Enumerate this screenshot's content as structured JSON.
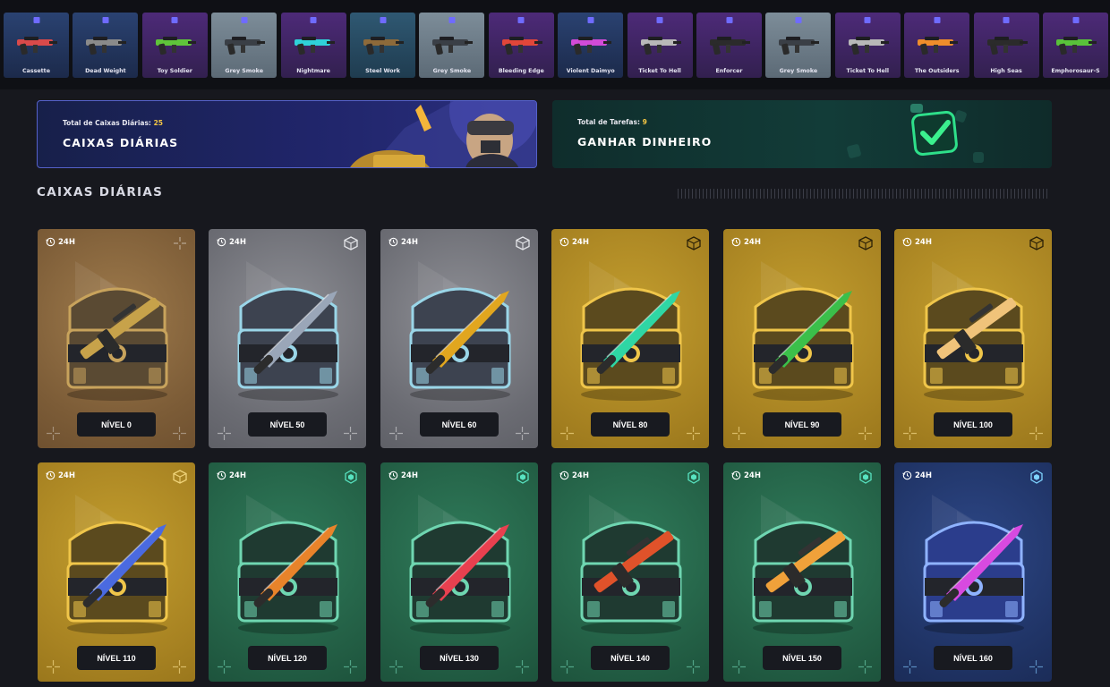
{
  "drops": [
    {
      "name": "Cassette",
      "rarity": "blue",
      "color": "#d94a4a"
    },
    {
      "name": "Dead Weight",
      "rarity": "blue",
      "color": "#8a8a8a"
    },
    {
      "name": "Toy Soldier",
      "rarity": "purple",
      "color": "#5fc43a"
    },
    {
      "name": "Grey Smoke",
      "rarity": "gray",
      "color": "#3a3f46"
    },
    {
      "name": "Nightmare",
      "rarity": "purple",
      "color": "#2fd1d8"
    },
    {
      "name": "Steel Work",
      "rarity": "teal",
      "color": "#8d6a3a"
    },
    {
      "name": "Grey Smoke",
      "rarity": "gray",
      "color": "#3a3f46"
    },
    {
      "name": "Bleeding Edge",
      "rarity": "purple",
      "color": "#e1463a"
    },
    {
      "name": "Violent Daimyo",
      "rarity": "blue",
      "color": "#d24bd8"
    },
    {
      "name": "Ticket To Hell",
      "rarity": "purple",
      "color": "#b8b8b8"
    },
    {
      "name": "Enforcer",
      "rarity": "purple",
      "color": "#2b2b2b"
    },
    {
      "name": "Grey Smoke",
      "rarity": "gray",
      "color": "#3a3f46"
    },
    {
      "name": "Ticket To Hell",
      "rarity": "purple",
      "color": "#b8b8b8"
    },
    {
      "name": "The Outsiders",
      "rarity": "purple",
      "color": "#ef8d2b"
    },
    {
      "name": "High Seas",
      "rarity": "purple",
      "color": "#2b2b2b"
    },
    {
      "name": "Emphorosaur-S",
      "rarity": "purple",
      "color": "#59c23a"
    }
  ],
  "banners": {
    "daily": {
      "count_label": "Total de Caixas Diárias:",
      "count": "25",
      "title": "CAIXAS DIÁRIAS"
    },
    "money": {
      "count_label": "Total de Tarefas:",
      "count": "9",
      "title": "GANHAR DINHEIRO"
    }
  },
  "section_title": "CAIXAS DIÁRIAS",
  "cards": [
    {
      "level": "NÍVEL 0",
      "timer": "24H",
      "theme": "bronze",
      "tier": "none",
      "weapon": "rifle",
      "accent": "#c7a24a"
    },
    {
      "level": "NÍVEL 50",
      "timer": "24H",
      "theme": "silver",
      "tier": "silver",
      "weapon": "knife",
      "accent": "#9aa6b8"
    },
    {
      "level": "NÍVEL 60",
      "timer": "24H",
      "theme": "silver",
      "tier": "silver",
      "weapon": "knife",
      "accent": "#e1a61f"
    },
    {
      "level": "NÍVEL 80",
      "timer": "24H",
      "theme": "gold",
      "tier": "gold",
      "weapon": "knife",
      "accent": "#2fd6a4"
    },
    {
      "level": "NÍVEL 90",
      "timer": "24H",
      "theme": "gold",
      "tier": "gold",
      "weapon": "knife",
      "accent": "#3bbf4a"
    },
    {
      "level": "NÍVEL 100",
      "timer": "24H",
      "theme": "gold",
      "tier": "gold",
      "weapon": "rifle",
      "accent": "#f0c37a"
    },
    {
      "level": "NÍVEL 110",
      "timer": "24H",
      "theme": "gold",
      "tier": "gold2",
      "weapon": "knife",
      "accent": "#4a6ae0"
    },
    {
      "level": "NÍVEL 120",
      "timer": "24H",
      "theme": "green",
      "tier": "green",
      "weapon": "knife",
      "accent": "#e8832a"
    },
    {
      "level": "NÍVEL 130",
      "timer": "24H",
      "theme": "green",
      "tier": "green",
      "weapon": "knife",
      "accent": "#e8404f"
    },
    {
      "level": "NÍVEL 140",
      "timer": "24H",
      "theme": "green",
      "tier": "green",
      "weapon": "rifle",
      "accent": "#e0522a"
    },
    {
      "level": "NÍVEL 150",
      "timer": "24H",
      "theme": "green",
      "tier": "green",
      "weapon": "rifle",
      "accent": "#f0a13a"
    },
    {
      "level": "NÍVEL 160",
      "timer": "24H",
      "theme": "blue",
      "tier": "blue",
      "weapon": "knife",
      "accent": "#d74ae0"
    }
  ]
}
